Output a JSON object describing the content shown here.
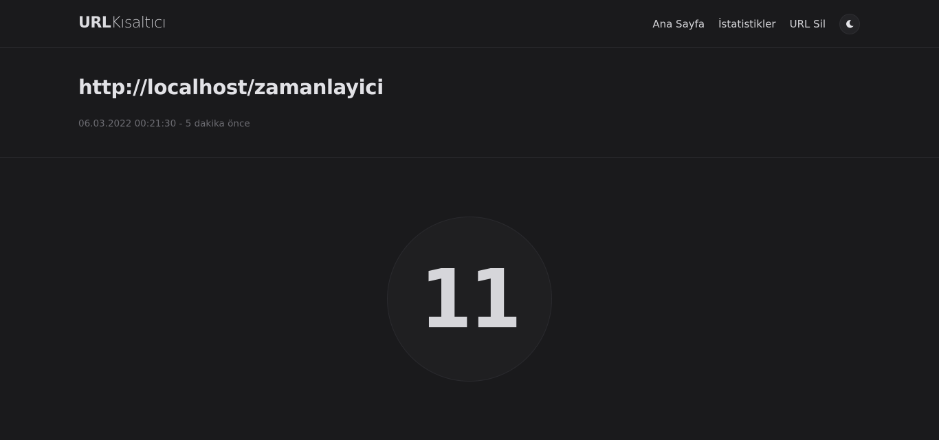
{
  "brand": {
    "bold": "URL",
    "light": "Kısaltıcı"
  },
  "nav": {
    "items": [
      {
        "label": "Ana Sayfa"
      },
      {
        "label": "İstatistikler"
      },
      {
        "label": "URL Sil"
      }
    ],
    "theme_icon": "moon-icon"
  },
  "link": {
    "url": "http://localhost/zamanlayici",
    "created": "06.03.2022 00:21:30",
    "separator": " - ",
    "relative": "5 dakika önce"
  },
  "timer": {
    "value": "11"
  }
}
